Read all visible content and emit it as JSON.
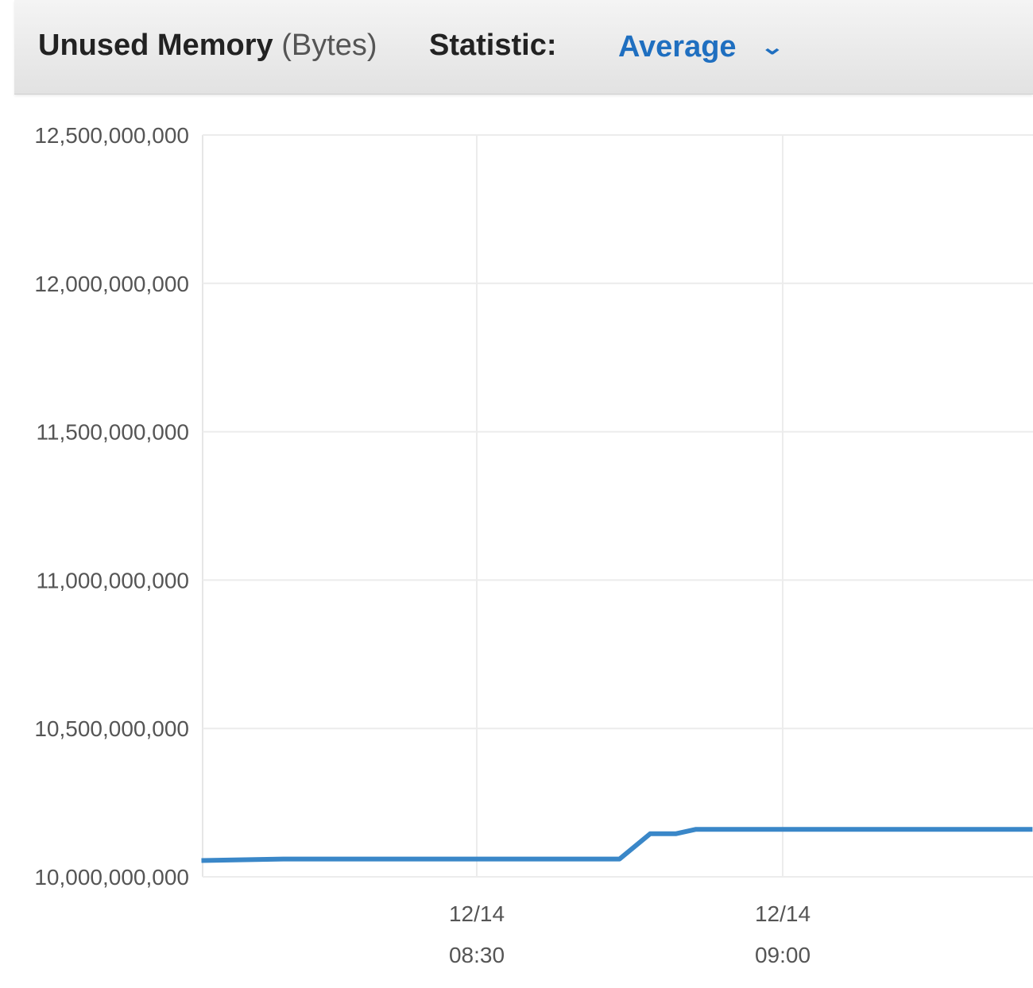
{
  "header": {
    "metric_name": "Unused Memory",
    "metric_unit": "(Bytes)",
    "statistic_label": "Statistic:",
    "statistic_value": "Average"
  },
  "colors": {
    "line": "#3a87c8",
    "accent": "#1f6fc0"
  },
  "chart_data": {
    "type": "line",
    "title": "Unused Memory (Bytes)",
    "xlabel": "",
    "ylabel": "Bytes",
    "ylim": [
      10000000000,
      12500000000
    ],
    "xlim_minutes_after_0800": [
      3,
      24.5
    ],
    "yticks": [
      {
        "value": 12500000000,
        "label": "12,500,000,000"
      },
      {
        "value": 12000000000,
        "label": "12,000,000,000"
      },
      {
        "value": 11500000000,
        "label": "11,500,000,000"
      },
      {
        "value": 11000000000,
        "label": "11,000,000,000"
      },
      {
        "value": 10500000000,
        "label": "10,500,000,000"
      },
      {
        "value": 10000000000,
        "label": "10,000,000,000"
      }
    ],
    "xticks": [
      {
        "minutes": 30,
        "date": "12/14",
        "time": "08:30"
      },
      {
        "minutes": 60,
        "date": "12/14",
        "time": "09:00"
      }
    ],
    "grid": true,
    "series": [
      {
        "name": "Average",
        "points": [
          {
            "x": 3,
            "y": 10055000000
          },
          {
            "x": 11,
            "y": 10060000000
          },
          {
            "x": 44,
            "y": 10060000000
          },
          {
            "x": 47,
            "y": 10145000000
          },
          {
            "x": 49.5,
            "y": 10145000000
          },
          {
            "x": 51.5,
            "y": 10160000000
          },
          {
            "x": 84.5,
            "y": 10160000000
          }
        ]
      }
    ]
  }
}
